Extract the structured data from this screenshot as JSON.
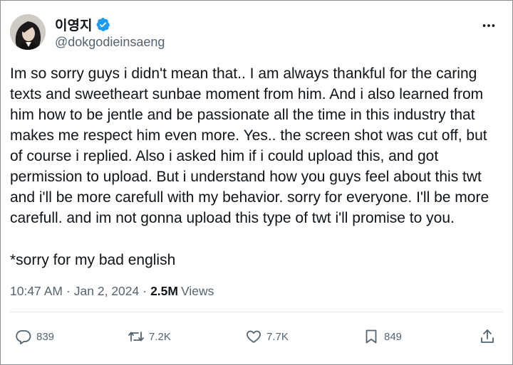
{
  "author": {
    "display_name": "이영지",
    "handle": "@dokgodieinsaeng",
    "verified": true,
    "avatar": "profile-photo"
  },
  "tweet": {
    "text": "Im so sorry guys i didn't mean that.. I am always thankful for the caring\ntexts and sweetheart sunbae moment from him. And i also learned from\nhim how to be jentle and be passionate all the time in this industry that\nmakes me respect him even more. Yes.. the screen shot was cut off, but\nof course i replied.  Also i asked him if i could upload this, and got\npermission to upload. But i understand how you guys feel about this twt\nand i'll be more carefull with my behavior. sorry for everyone. I'll be more\ncarefull. and im not gonna upload this type of twt i'll promise to you.",
    "footnote": "*sorry for my bad english"
  },
  "meta": {
    "time": "10:47 AM",
    "separator": "·",
    "date": "Jan 2, 2024",
    "views_count": "2.5M",
    "views_label": "Views"
  },
  "actions": {
    "reply": {
      "icon": "reply-icon",
      "count": "839"
    },
    "repost": {
      "icon": "repost-icon",
      "count": "7.2K"
    },
    "like": {
      "icon": "heart-icon",
      "count": "7.7K"
    },
    "bookmark": {
      "icon": "bookmark-icon",
      "count": "849"
    },
    "share": {
      "icon": "share-icon"
    }
  },
  "colors": {
    "text": "#0f1419",
    "secondary": "#536471",
    "verified": "#1d9bf0",
    "border": "#8a8f94",
    "divider": "#e1e5e8"
  }
}
